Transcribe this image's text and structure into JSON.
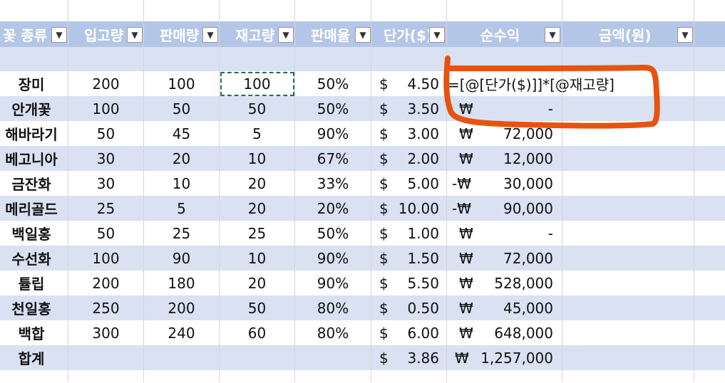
{
  "headers": [
    {
      "label": "꽃 종류"
    },
    {
      "label": "입고량"
    },
    {
      "label": "판매량"
    },
    {
      "label": "재고량"
    },
    {
      "label": "판매율"
    },
    {
      "label": "단가($)"
    },
    {
      "label": "순수익"
    },
    {
      "label": "금액(원)"
    }
  ],
  "rows": [
    {
      "name": "장미",
      "in": "200",
      "sold": "100",
      "stock": "100",
      "rate": "50%",
      "cur": "$",
      "price": "4.50",
      "won": "",
      "profit": "=[@[단가($)]]*[@재고량]"
    },
    {
      "name": "안개꽃",
      "in": "100",
      "sold": "50",
      "stock": "50",
      "rate": "50%",
      "cur": "$",
      "price": "3.50",
      "won": "₩",
      "profit": "-"
    },
    {
      "name": "해바라기",
      "in": "50",
      "sold": "45",
      "stock": "5",
      "rate": "90%",
      "cur": "$",
      "price": "3.00",
      "won": "₩",
      "profit": "72,000"
    },
    {
      "name": "베고니아",
      "in": "30",
      "sold": "20",
      "stock": "10",
      "rate": "67%",
      "cur": "$",
      "price": "2.00",
      "won": "₩",
      "profit": "12,000"
    },
    {
      "name": "금잔화",
      "in": "30",
      "sold": "10",
      "stock": "20",
      "rate": "33%",
      "cur": "$",
      "price": "5.00",
      "won": "-₩",
      "profit": "30,000"
    },
    {
      "name": "메리골드",
      "in": "25",
      "sold": "5",
      "stock": "20",
      "rate": "20%",
      "cur": "$",
      "price": "10.00",
      "won": "-₩",
      "profit": "90,000"
    },
    {
      "name": "백일홍",
      "in": "50",
      "sold": "25",
      "stock": "25",
      "rate": "50%",
      "cur": "$",
      "price": "1.00",
      "won": "₩",
      "profit": "-"
    },
    {
      "name": "수선화",
      "in": "100",
      "sold": "90",
      "stock": "10",
      "rate": "90%",
      "cur": "$",
      "price": "1.50",
      "won": "₩",
      "profit": "72,000"
    },
    {
      "name": "튤립",
      "in": "200",
      "sold": "180",
      "stock": "20",
      "rate": "90%",
      "cur": "$",
      "price": "5.50",
      "won": "₩",
      "profit": "528,000"
    },
    {
      "name": "천일홍",
      "in": "250",
      "sold": "200",
      "stock": "50",
      "rate": "80%",
      "cur": "$",
      "price": "0.50",
      "won": "₩",
      "profit": "45,000"
    },
    {
      "name": "백합",
      "in": "300",
      "sold": "240",
      "stock": "60",
      "rate": "80%",
      "cur": "$",
      "price": "6.00",
      "won": "₩",
      "profit": "648,000"
    }
  ],
  "total": {
    "name": "합계",
    "cur": "$",
    "price": "3.86",
    "won": "₩",
    "profit": "1,257,000"
  },
  "colors": {
    "header_bg": "#b4c6e7",
    "band_bg": "#d9e1f2",
    "annotation": "#e8520f",
    "selection": "#217346"
  },
  "icons": {
    "filter": "chevron-down-icon"
  }
}
